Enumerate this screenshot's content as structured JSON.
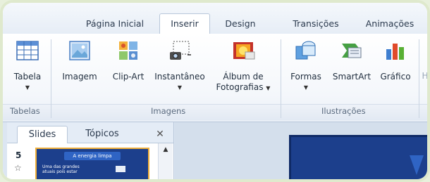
{
  "tabs": [
    {
      "label": "Página Inicial",
      "active": false
    },
    {
      "label": "Inserir",
      "active": true
    },
    {
      "label": "Design",
      "active": false
    },
    {
      "label": "Transições",
      "active": false
    },
    {
      "label": "Animações",
      "active": false
    }
  ],
  "ribbon": {
    "tabela": "Tabela",
    "imagem": "Imagem",
    "clipart": "Clip-Art",
    "instantaneo": "Instantâneo",
    "album_line1": "Álbum de",
    "album_line2": "Fotografias",
    "formas": "Formas",
    "smartart": "SmartArt",
    "grafico": "Gráfico",
    "truncated": "H",
    "groups": {
      "tabelas": "Tabelas",
      "imagens": "Imagens",
      "ilustracoes": "Ilustrações"
    }
  },
  "panel": {
    "tab_slides": "Slides",
    "tab_topicos": "Tópicos",
    "close": "✕",
    "slide_number": "5",
    "slide_title": "A energia limpa",
    "slide_text": "Uma das grandes atuais pois estar"
  },
  "colors": {
    "accent_blue": "#1f4e9a",
    "slide_bg": "#1c3f8c"
  }
}
